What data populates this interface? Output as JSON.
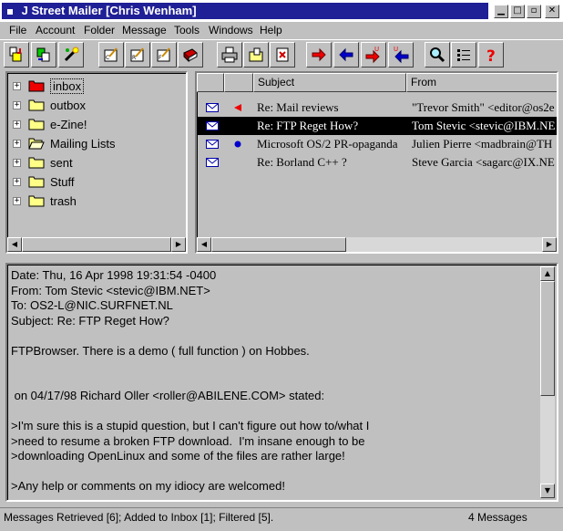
{
  "window": {
    "title": "J Street Mailer [Chris Wenham]",
    "buttons": {
      "minimize": "▁",
      "maximize": "□",
      "restore": "▫",
      "close": "✕"
    }
  },
  "menu": [
    "File",
    "Account",
    "Folder",
    "Message",
    "Tools",
    "Windows",
    "Help"
  ],
  "toolbar": {
    "buttons": [
      "get-mail",
      "send-queue",
      "connect",
      "compose-new",
      "reply",
      "forward",
      "address-book",
      "print",
      "save",
      "delete",
      "next-message",
      "previous-message",
      "next-unread",
      "previous-unread",
      "search",
      "list-view",
      "help"
    ]
  },
  "folders": [
    {
      "label": "inbox",
      "selected": true,
      "color": "#ff0000"
    },
    {
      "label": "outbox"
    },
    {
      "label": "e-Zine!"
    },
    {
      "label": "Mailing Lists",
      "open": true
    },
    {
      "label": "sent"
    },
    {
      "label": "Stuff"
    },
    {
      "label": "trash"
    }
  ],
  "message_list": {
    "columns": [
      "",
      "",
      "Subject",
      "From"
    ],
    "rows": [
      {
        "subject": "Re: Mail reviews",
        "from": "\"Trevor Smith\" <editor@os2e",
        "status": "replied",
        "selected": false
      },
      {
        "subject": "Re: FTP Reget How?",
        "from": "Tom Stevic <stevic@IBM.NE",
        "status": "",
        "selected": true
      },
      {
        "subject": "Microsoft OS/2 PR-opaganda",
        "from": "Julien Pierre <madbrain@TH",
        "status": "unread",
        "selected": false
      },
      {
        "subject": "Re: Borland C++ ?",
        "from": "Steve Garcia <sagarc@IX.NE",
        "status": "",
        "selected": false
      }
    ]
  },
  "message": {
    "date": "Date: Thu, 16 Apr 1998 19:31:54 -0400",
    "from": "From: Tom Stevic <stevic@IBM.NET>",
    "to": "To: OS2-L@NIC.SURFNET.NL",
    "subject": "Subject: Re: FTP Reget How?",
    "body": "\nFTPBrowser. There is a demo ( full function ) on Hobbes.\n\n\n on 04/17/98 Richard Oller <roller@ABILENE.COM> stated:\n\n>I'm sure this is a stupid question, but I can't figure out how to/what I\n>need to resume a broken FTP download.  I'm insane enough to be\n>downloading OpenLinux and some of the files are rather large!\n\n>Any help or comments on my idiocy are welcomed!"
  },
  "status": {
    "left": "Messages Retrieved [6];  Added to Inbox [1];  Filtered [5].",
    "right": "4 Messages"
  },
  "colors": {
    "titlebar": "#1f1f96",
    "face": "#c0c0c0",
    "selection": "#000000",
    "accent_red": "#e00000",
    "accent_blue": "#0000c0"
  }
}
